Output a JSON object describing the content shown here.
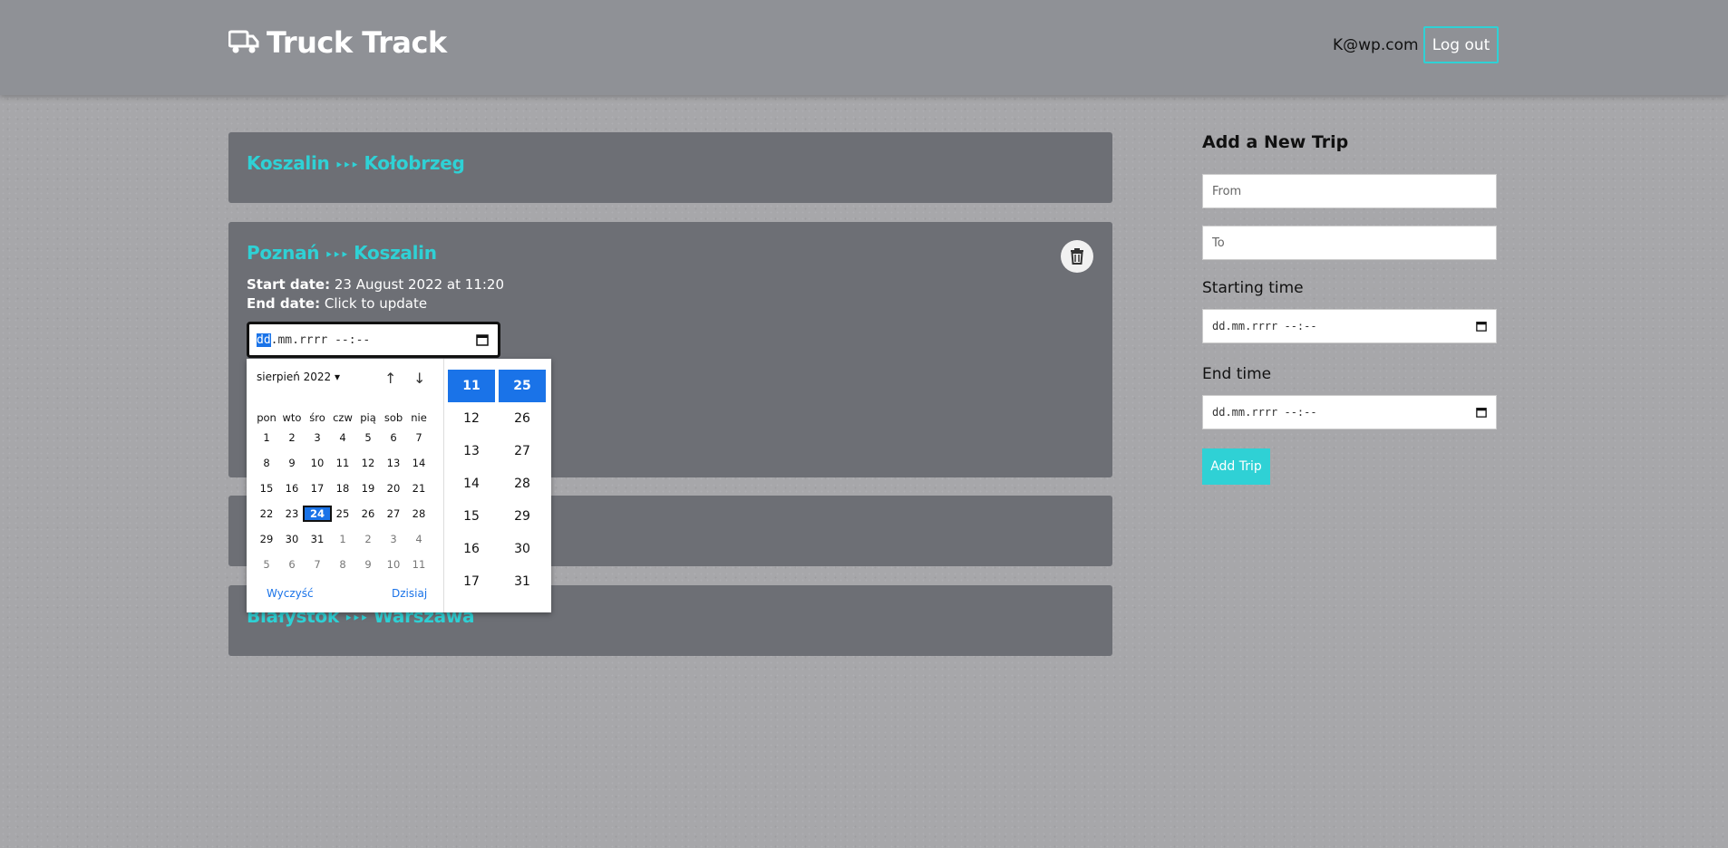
{
  "header": {
    "app_name": "Truck Track",
    "user_email": "K@wp.com",
    "logout_label": "Log out"
  },
  "trips": [
    {
      "from": "Koszalin",
      "to": "Kołobrzeg"
    },
    {
      "from": "Poznań",
      "to": "Koszalin",
      "start_label": "Start date:",
      "start_value": "23 August 2022 at 11:20",
      "end_label": "End date:",
      "end_value": "Click to update",
      "input_value_selected": "dd",
      "input_value_rest": ".mm.rrrr --:--"
    },
    {
      "from": "",
      "to": ""
    },
    {
      "from": "Białystok",
      "to": "Warszawa"
    }
  ],
  "arrow_glyph": "‣‣‣",
  "datepicker": {
    "month_label": "sierpień 2022",
    "weekdays": [
      "pon",
      "wto",
      "śro",
      "czw",
      "pią",
      "sob",
      "nie"
    ],
    "weeks": [
      [
        "1",
        "2",
        "3",
        "4",
        "5",
        "6",
        "7"
      ],
      [
        "8",
        "9",
        "10",
        "11",
        "12",
        "13",
        "14"
      ],
      [
        "15",
        "16",
        "17",
        "18",
        "19",
        "20",
        "21"
      ],
      [
        "22",
        "23",
        "24",
        "25",
        "26",
        "27",
        "28"
      ],
      [
        "29",
        "30",
        "31",
        "1",
        "2",
        "3",
        "4"
      ],
      [
        "5",
        "6",
        "7",
        "8",
        "9",
        "10",
        "11"
      ]
    ],
    "today": "24",
    "clear_label": "Wyczyść",
    "today_label": "Dzisiaj",
    "hours": [
      "11",
      "12",
      "13",
      "14",
      "15",
      "16",
      "17"
    ],
    "minutes": [
      "25",
      "26",
      "27",
      "28",
      "29",
      "30",
      "31"
    ],
    "selected_hour": "11",
    "selected_minute": "25"
  },
  "sidebar": {
    "title": "Add a New Trip",
    "from_placeholder": "From",
    "to_placeholder": "To",
    "start_label": "Starting time",
    "end_label": "End time",
    "dt_placeholder": "dd.mm.rrrr --:--",
    "submit_label": "Add Trip"
  },
  "colors": {
    "accent": "#2fd1d5",
    "card": "#6d6f75",
    "header": "#8f9196",
    "selection": "#1a73e8"
  }
}
